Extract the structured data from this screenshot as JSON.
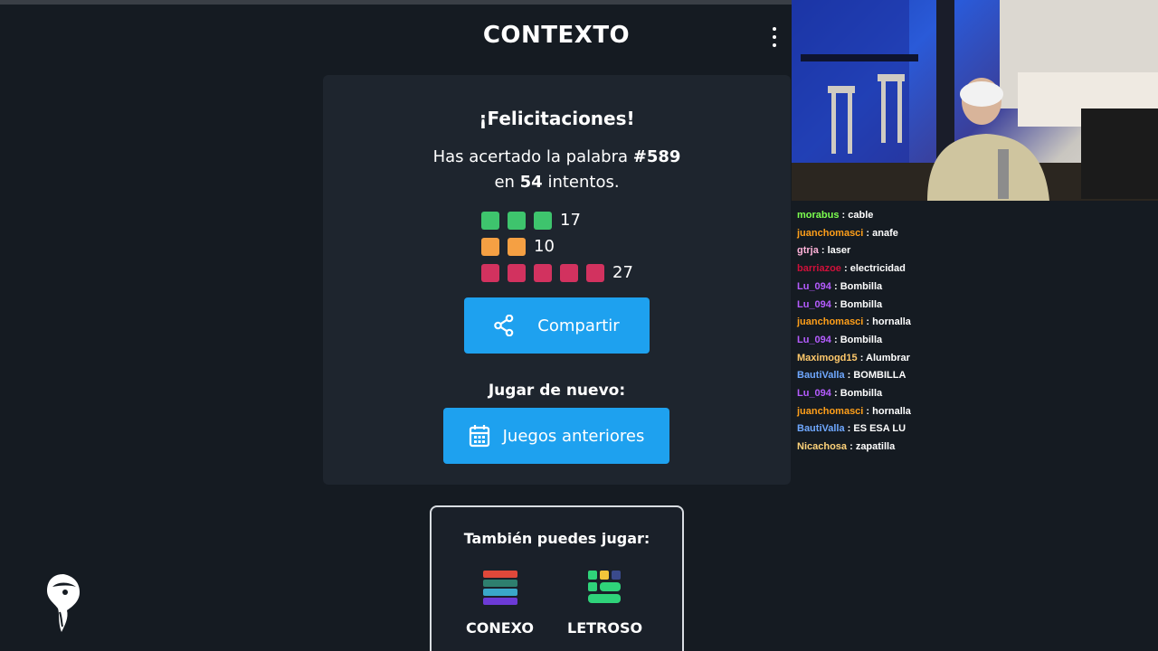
{
  "header": {
    "title": "CONTEXTO"
  },
  "result": {
    "congrats": "¡Felicitaciones!",
    "line1_prefix": "Has acertado la palabra ",
    "word_number": "#589",
    "line2_prefix": "en ",
    "attempts": "54",
    "line2_suffix": " intentos."
  },
  "distribution": [
    {
      "color": "green",
      "squares": 3,
      "count": "17"
    },
    {
      "color": "orange",
      "squares": 2,
      "count": "10"
    },
    {
      "color": "red",
      "squares": 5,
      "count": "27"
    }
  ],
  "buttons": {
    "share": "Compartir",
    "play_again_label": "Jugar de nuevo:",
    "previous_games": "Juegos anteriores"
  },
  "also_play": {
    "title": "También puedes jugar:",
    "games": [
      "CONEXO",
      "LETROSO"
    ]
  },
  "chat": [
    {
      "user": "morabus",
      "color": "#7cff4f",
      "text": "cable"
    },
    {
      "user": "juanchomasci",
      "color": "#ff9f1a",
      "text": "anafe"
    },
    {
      "user": "gtrja",
      "color": "#ffb3d9",
      "text": "laser"
    },
    {
      "user": "barriazoe",
      "color": "#d0103a",
      "text": "electricidad"
    },
    {
      "user": "Lu_094",
      "color": "#b55cff",
      "text": "Bombilla"
    },
    {
      "user": "Lu_094",
      "color": "#b55cff",
      "text": "Bombilla"
    },
    {
      "user": "juanchomasci",
      "color": "#ff9f1a",
      "text": "hornalla"
    },
    {
      "user": "Lu_094",
      "color": "#b55cff",
      "text": "Bombilla"
    },
    {
      "user": "Maximogd15",
      "color": "#ffc96b",
      "text": "Alumbrar"
    },
    {
      "user": "BautiValla",
      "color": "#6fa8ff",
      "text": "BOMBILLA"
    },
    {
      "user": "Lu_094",
      "color": "#b55cff",
      "text": "Bombilla"
    },
    {
      "user": "juanchomasci",
      "color": "#ff9f1a",
      "text": "hornalla"
    },
    {
      "user": "BautiValla",
      "color": "#6fa8ff",
      "text": "ES ESA LU"
    },
    {
      "user": "Nicachosa",
      "color": "#ffd37a",
      "text": "zapatilla"
    }
  ]
}
